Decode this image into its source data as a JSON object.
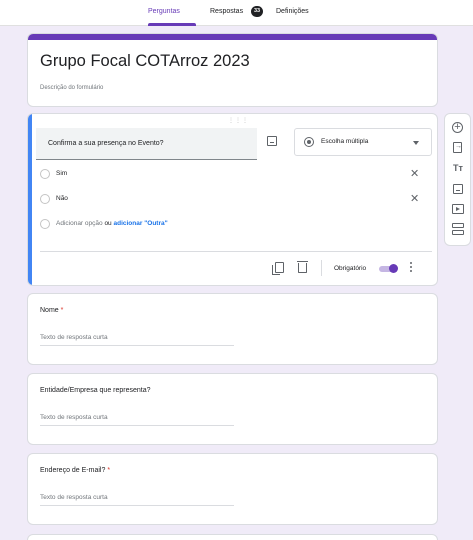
{
  "tabs": [
    {
      "label": "Perguntas",
      "active": true
    },
    {
      "label": "Respostas",
      "badge": "33"
    },
    {
      "label": "Definições"
    }
  ],
  "form": {
    "title": "Grupo Focal COTArroz 2023",
    "description_placeholder": "Descrição do formulário"
  },
  "active_question": {
    "title": "Confirma a sua presença no Evento?",
    "type": "Escolha múltipla",
    "options": [
      "Sim",
      "Não"
    ],
    "add_option": "Adicionar opção",
    "or": "ou",
    "add_other": "adicionar \"Outra\"",
    "required_label": "Obrigatório",
    "required": true
  },
  "questions": [
    {
      "label": "Nome",
      "required": "*",
      "placeholder": "Texto de resposta curta"
    },
    {
      "label": "Entidade/Empresa que representa?",
      "required": "",
      "placeholder": "Texto de resposta curta"
    },
    {
      "label": "Endereço de E-mail?",
      "required": "*",
      "placeholder": "Texto de resposta curta"
    }
  ],
  "toolbar": {
    "title_glyph": "Tт"
  },
  "colors": {
    "accent": "#673ab7",
    "background": "#f0ebf8",
    "active_border": "#4285f4",
    "link": "#1a73e8",
    "required_star": "#d93025"
  }
}
